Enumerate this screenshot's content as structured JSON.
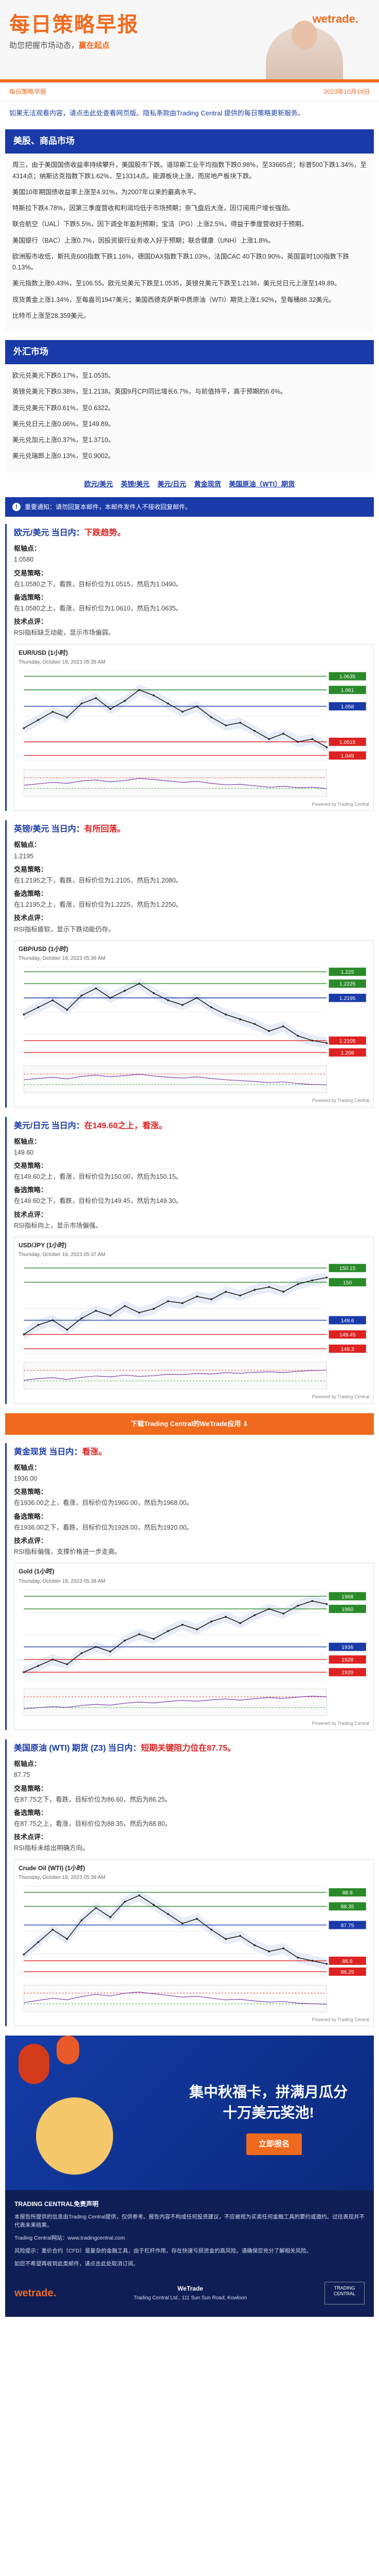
{
  "banner": {
    "title": "每日策略早报",
    "subtitle_pre": "助您把握市场动态，",
    "subtitle_hi": "赢在起点",
    "brand": "wetrade."
  },
  "meta": {
    "left": "每日策略早报",
    "right": "2023年10月19日"
  },
  "intro": "如果无法观看内容，请点击此处查看网页版。隐私条款由Trading Central 提供的每日策略更新服务。",
  "sections": {
    "macro": {
      "head": "美股、商品市场",
      "paragraphs": [
        "周三，由于美国国债收益率持续攀升，美国股市下跌。道琼斯工业平均指数下跌0.98%，至33665点；标普500下跌1.34%，至4314点；纳斯达克指数下跌1.62%，至13314点。能源板块上涨，而房地产板块下跌。",
        "美国10年期国债收益率上涨至4.91%，为2007年以来的最高水平。",
        "特斯拉下跌4.78%，因第三季度营收和利润均低于市场预期；奈飞盘后大涨，因订阅用户增长强劲。",
        "联合航空（UAL）下跌5.5%，因下调全年盈利预期；宝洁（PG）上涨2.5%，得益于季度营收好于预期。",
        "美国银行（BAC）上涨0.7%，因投资银行业务收入好于预期；联合健康（UNH）上涨1.8%。",
        "欧洲股市收低，斯托克600指数下跌1.16%，德国DAX指数下跌1.03%，法国CAC 40下跌0.90%，英国富时100指数下跌0.13%。",
        "美元指数上涨0.43%，至106.55。欧元兑美元下跌至1.0535，英镑兑美元下跌至1.2138，美元兑日元上涨至149.89。",
        "现货黄金上涨1.34%，至每盎司1947美元；美国西德克萨斯中质原油（WTI）期货上涨1.92%，至每桶88.32美元。"
      ],
      "tail": "比特币上涨至28,359美元。"
    },
    "fx": {
      "head": "外汇市场",
      "paragraphs": [
        "欧元兑美元下跌0.17%，至1.0535。",
        "英镑兑美元下跌0.38%，至1.2138。英国9月CPI同比增长6.7%，与前值持平，高于预期的6.6%。",
        "澳元兑美元下跌0.61%，至0.6322。",
        "美元兑日元上涨0.06%，至149.89。",
        "美元兑加元上涨0.37%，至1.3710。",
        "美元兑瑞郎上涨0.13%，至0.9002。"
      ]
    }
  },
  "links": [
    "欧元/美元",
    "英镑/美元",
    "美元/日元",
    "黄金现货",
    "美国原油（WTI）期货"
  ],
  "notice": "重要通知：请勿回复本邮件，本邮件发件人不接收回复邮件。",
  "assets": [
    {
      "title_pre": "欧元/美元 当日内：",
      "title_acc": "下跌趋势。",
      "pivot_label": "枢轴点：",
      "pivot": "1.0580",
      "strategy_label": "交易策略：",
      "strategy": "在1.0580之下，看跌，目标价位为1.0515，然后为1.0490。",
      "alt_label": "备选策略：",
      "alt": "在1.0580之上，看涨，目标价位为1.0610，然后为1.0635。",
      "tech_label": "技术点评：",
      "tech": "RSI指标缺乏动能，显示市场偏弱。",
      "chart_title": "EUR/USD (1小时)",
      "chart_date": "Thursday, October 19, 2023 05:35 AM",
      "chart_wm": "Powered by Trading Central"
    },
    {
      "title_pre": "英镑/美元 当日内：",
      "title_acc": "有所回落。",
      "pivot_label": "枢轴点：",
      "pivot": "1.2195",
      "strategy_label": "交易策略：",
      "strategy": "在1.2195之下，看跌，目标价位为1.2105，然后为1.2080。",
      "alt_label": "备选策略：",
      "alt": "在1.2195之上，看涨，目标价位为1.2225，然后为1.2250。",
      "tech_label": "技术点评：",
      "tech": "RSI指标疲软，显示下跌动能仍存。",
      "chart_title": "GBP/USD (1小时)",
      "chart_date": "Thursday, October 19, 2023 05:36 AM",
      "chart_wm": "Powered by Trading Central"
    },
    {
      "title_pre": "美元/日元 当日内：",
      "title_acc": "在149.60之上，看涨。",
      "pivot_label": "枢轴点：",
      "pivot": "149.60",
      "strategy_label": "交易策略：",
      "strategy": "在149.60之上，看涨，目标价位为150.00，然后为150.15。",
      "alt_label": "备选策略：",
      "alt": "在149.60之下，看跌，目标价位为149.45，然后为149.30。",
      "tech_label": "技术点评：",
      "tech": "RSI指标向上，显示市场偏强。",
      "chart_title": "USD/JPY (1小时)",
      "chart_date": "Thursday, October 19, 2023 05:37 AM",
      "chart_wm": "Powered by Trading Central"
    },
    {
      "title_pre": "黄金现货 当日内：",
      "title_acc": "看涨。",
      "pivot_label": "枢轴点：",
      "pivot": "1936.00",
      "strategy_label": "交易策略：",
      "strategy": "在1936.00之上，看涨，目标价位为1960.00，然后为1968.00。",
      "alt_label": "备选策略：",
      "alt": "在1936.00之下，看跌，目标价位为1928.00，然后为1920.00。",
      "tech_label": "技术点评：",
      "tech": "RSI指标偏强，支撑价格进一步走高。",
      "chart_title": "Gold (1小时)",
      "chart_date": "Thursday, October 19, 2023 05:38 AM",
      "chart_wm": "Powered by Trading Central"
    },
    {
      "title_pre": "美国原油 (WTI) 期货 (Z3) 当日内：",
      "title_acc": "短期关键阻力位在87.75。",
      "pivot_label": "枢轴点：",
      "pivot": "87.75",
      "strategy_label": "交易策略：",
      "strategy": "在87.75之下，看跌，目标价位为86.60，然后为86.25。",
      "alt_label": "备选策略：",
      "alt": "在87.75之上，看涨，目标价位为88.35，然后为88.80。",
      "tech_label": "技术点评：",
      "tech": "RSI指标未给出明确方向。",
      "chart_title": "Crude Oil (WTI) (1小时)",
      "chart_date": "Thursday, October 19, 2023 05:39 AM",
      "chart_wm": "Powered by Trading Central"
    }
  ],
  "orange_banner": "下载Trading Central的WeTrade应用  ⬇",
  "promo": {
    "headline": "集中秋福卡，拼满月瓜分十万美元奖池!",
    "cta": "立即报名"
  },
  "footer": {
    "heading": "TRADING CENTRAL免责声明",
    "p1": "本报告所提供的信息由Trading Central提供，仅供参考。报告内容不构成任何投资建议，不应被视为买卖任何金融工具的要约或邀约。过往表现并不代表未来结果。",
    "p2": "Trading Central网站：www.tradingcentral.com",
    "p3": "风险提示：差价合约（CFD）是复杂的金融工具，由于杠杆作用，存在快速亏损资金的高风险。请确保您充分了解相关风险。",
    "p4": "如您不希望再收到此类邮件，请点击此处取消订阅。",
    "company": "WeTrade",
    "address": "Trading Central Ltd., 111 Sun Sun Road, Kowloon",
    "brand": "wetrade.",
    "badge": "TRADING CENTRAL"
  },
  "chart_data": [
    {
      "type": "line",
      "title": "EUR/USD (1小时)",
      "series": [
        {
          "values": [
            1.054,
            1.0555,
            1.057,
            1.056,
            1.0585,
            1.0595,
            1.0575,
            1.059,
            1.061,
            1.06,
            1.0585,
            1.057,
            1.058,
            1.056,
            1.0545,
            1.055,
            1.0535,
            1.052,
            1.053,
            1.0515,
            1.052,
            1.0505
          ]
        }
      ],
      "levels": [
        1.0635,
        1.061,
        1.058,
        1.0515,
        1.049
      ],
      "level_colors": [
        "#2a8a2a",
        "#2a8a2a",
        "#1a3aa8",
        "#d22",
        "#d22"
      ],
      "ylim": [
        1.048,
        1.0645
      ]
    },
    {
      "type": "line",
      "title": "GBP/USD (1小时)",
      "series": [
        {
          "values": [
            1.216,
            1.2175,
            1.219,
            1.217,
            1.22,
            1.2215,
            1.2195,
            1.221,
            1.2225,
            1.2205,
            1.219,
            1.218,
            1.2195,
            1.2175,
            1.216,
            1.215,
            1.214,
            1.2125,
            1.2135,
            1.2115,
            1.2105,
            1.21
          ]
        }
      ],
      "levels": [
        1.225,
        1.2225,
        1.2195,
        1.2105,
        1.208
      ],
      "level_colors": [
        "#2a8a2a",
        "#2a8a2a",
        "#1a3aa8",
        "#d22",
        "#d22"
      ],
      "ylim": [
        1.207,
        1.226
      ]
    },
    {
      "type": "line",
      "title": "USD/JPY (1小时)",
      "series": [
        {
          "values": [
            149.45,
            149.55,
            149.6,
            149.5,
            149.62,
            149.7,
            149.65,
            149.75,
            149.68,
            149.72,
            149.8,
            149.78,
            149.85,
            149.82,
            149.9,
            149.86,
            149.92,
            149.95,
            149.9,
            149.98,
            150.02,
            150.05
          ]
        }
      ],
      "levels": [
        150.15,
        150.0,
        149.6,
        149.45,
        149.3
      ],
      "level_colors": [
        "#2a8a2a",
        "#2a8a2a",
        "#1a3aa8",
        "#d22",
        "#d22"
      ],
      "ylim": [
        149.25,
        150.2
      ]
    },
    {
      "type": "line",
      "title": "Gold (1小时)",
      "series": [
        {
          "values": [
            1920,
            1924,
            1928,
            1925,
            1932,
            1936,
            1933,
            1940,
            1944,
            1941,
            1946,
            1950,
            1947,
            1952,
            1955,
            1951,
            1956,
            1960,
            1957,
            1962,
            1965,
            1963
          ]
        }
      ],
      "levels": [
        1968,
        1960,
        1936,
        1928,
        1920
      ],
      "level_colors": [
        "#2a8a2a",
        "#2a8a2a",
        "#1a3aa8",
        "#d22",
        "#d22"
      ],
      "ylim": [
        1915,
        1972
      ]
    },
    {
      "type": "line",
      "title": "Crude Oil (WTI) (1小时)",
      "series": [
        {
          "values": [
            86.8,
            87.2,
            87.6,
            87.3,
            87.9,
            88.3,
            88.0,
            88.5,
            88.7,
            88.4,
            88.1,
            87.8,
            87.95,
            87.6,
            87.3,
            87.4,
            87.1,
            86.9,
            87.0,
            86.7,
            86.6,
            86.5
          ]
        }
      ],
      "levels": [
        88.8,
        88.35,
        87.75,
        86.6,
        86.25
      ],
      "level_colors": [
        "#2a8a2a",
        "#2a8a2a",
        "#1a3aa8",
        "#d22",
        "#d22"
      ],
      "ylim": [
        86.1,
        89.0
      ]
    }
  ]
}
